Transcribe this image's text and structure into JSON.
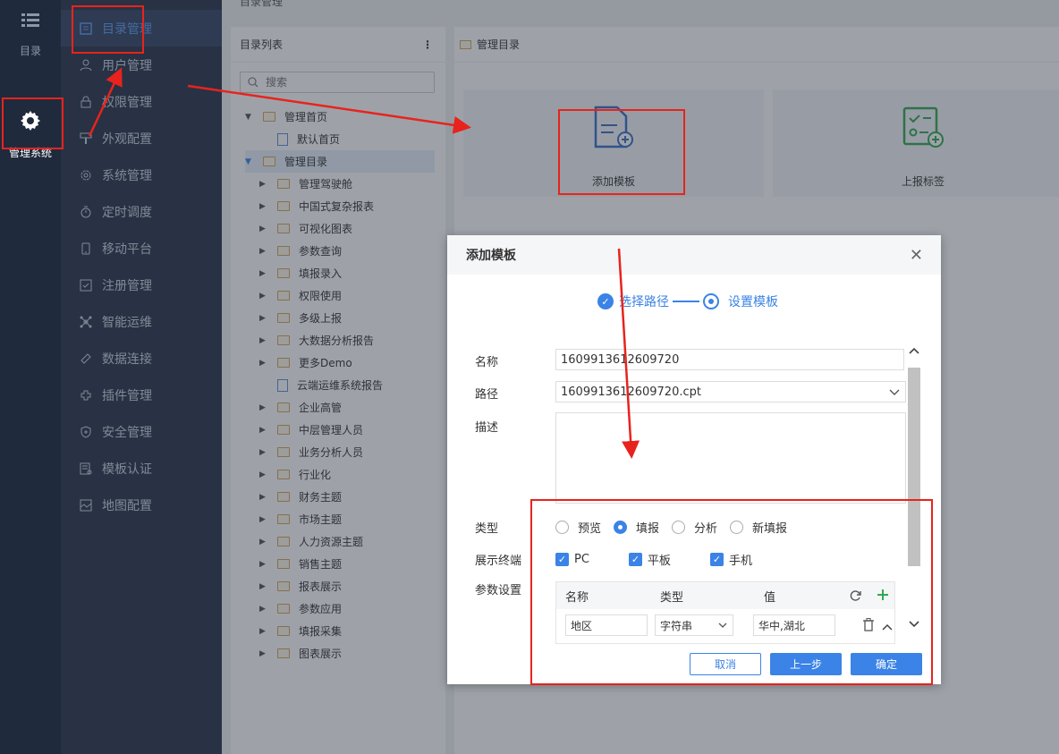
{
  "topbar": {
    "title": "目录管理"
  },
  "rail": {
    "items": [
      {
        "label": "目录",
        "icon": "list-icon"
      },
      {
        "label": "管理系统",
        "icon": "gear-icon"
      }
    ]
  },
  "nav": {
    "items": [
      {
        "label": "目录管理",
        "icon": "catalog-icon"
      },
      {
        "label": "用户管理",
        "icon": "user-icon"
      },
      {
        "label": "权限管理",
        "icon": "lock-icon"
      },
      {
        "label": "外观配置",
        "icon": "brush-icon"
      },
      {
        "label": "系统管理",
        "icon": "settings-icon"
      },
      {
        "label": "定时调度",
        "icon": "timer-icon"
      },
      {
        "label": "移动平台",
        "icon": "mobile-icon"
      },
      {
        "label": "注册管理",
        "icon": "register-icon"
      },
      {
        "label": "智能运维",
        "icon": "ops-icon"
      },
      {
        "label": "数据连接",
        "icon": "link-icon"
      },
      {
        "label": "插件管理",
        "icon": "plugin-icon"
      },
      {
        "label": "安全管理",
        "icon": "shield-icon"
      },
      {
        "label": "模板认证",
        "icon": "cert-icon"
      },
      {
        "label": "地图配置",
        "icon": "map-icon"
      }
    ]
  },
  "catalog": {
    "title": "目录列表",
    "search_placeholder": "搜索",
    "tree": [
      {
        "label": "管理首页",
        "level": 0,
        "type": "folder",
        "expanded": true
      },
      {
        "label": "默认首页",
        "level": 1,
        "type": "home"
      },
      {
        "label": "管理目录",
        "level": 0,
        "type": "folder",
        "expanded": true,
        "selected": true
      },
      {
        "label": "管理驾驶舱",
        "level": 1,
        "type": "folder"
      },
      {
        "label": "中国式复杂报表",
        "level": 1,
        "type": "folder"
      },
      {
        "label": "可视化图表",
        "level": 1,
        "type": "folder"
      },
      {
        "label": "参数查询",
        "level": 1,
        "type": "folder"
      },
      {
        "label": "填报录入",
        "level": 1,
        "type": "folder"
      },
      {
        "label": "权限使用",
        "level": 1,
        "type": "folder"
      },
      {
        "label": "多级上报",
        "level": 1,
        "type": "folder"
      },
      {
        "label": "大数据分析报告",
        "level": 1,
        "type": "folder"
      },
      {
        "label": "更多Demo",
        "level": 1,
        "type": "folder"
      },
      {
        "label": "云端运维系统报告",
        "level": 1,
        "type": "doc"
      },
      {
        "label": "企业高管",
        "level": 1,
        "type": "folder"
      },
      {
        "label": "中层管理人员",
        "level": 1,
        "type": "folder"
      },
      {
        "label": "业务分析人员",
        "level": 1,
        "type": "folder"
      },
      {
        "label": "行业化",
        "level": 1,
        "type": "folder"
      },
      {
        "label": "财务主题",
        "level": 1,
        "type": "folder"
      },
      {
        "label": "市场主题",
        "level": 1,
        "type": "folder"
      },
      {
        "label": "人力资源主题",
        "level": 1,
        "type": "folder"
      },
      {
        "label": "销售主题",
        "level": 1,
        "type": "folder"
      },
      {
        "label": "报表展示",
        "level": 1,
        "type": "folder"
      },
      {
        "label": "参数应用",
        "level": 1,
        "type": "folder"
      },
      {
        "label": "填报采集",
        "level": 1,
        "type": "folder"
      },
      {
        "label": "图表展示",
        "level": 1,
        "type": "folder"
      }
    ]
  },
  "manage": {
    "title": "管理目录",
    "tiles": [
      {
        "label": "添加模板",
        "icon": "add-template-icon"
      },
      {
        "label": "上报标签",
        "icon": "report-tag-icon"
      }
    ]
  },
  "modal": {
    "title": "添加模板",
    "steps": [
      "选择路径",
      "设置模板"
    ],
    "name_label": "名称",
    "name_value": "1609913612609720",
    "path_label": "路径",
    "path_value": "1609913612609720.cpt",
    "desc_label": "描述",
    "type_label": "类型",
    "type_options": [
      "预览",
      "填报",
      "分析",
      "新填报"
    ],
    "type_selected": "填报",
    "terminal_label": "展示终端",
    "terminal_options": [
      "PC",
      "平板",
      "手机"
    ],
    "param_label": "参数设置",
    "param_headers": [
      "名称",
      "类型",
      "值"
    ],
    "param_row": {
      "name": "地区",
      "type": "字符串",
      "value": "华中,湖北"
    },
    "cancel": "取消",
    "prev": "上一步",
    "ok": "确定"
  },
  "colors": {
    "accent": "#3b83e6",
    "annotation": "#e8231d",
    "rail": "#1f2a3d",
    "nav": "#28344a"
  }
}
